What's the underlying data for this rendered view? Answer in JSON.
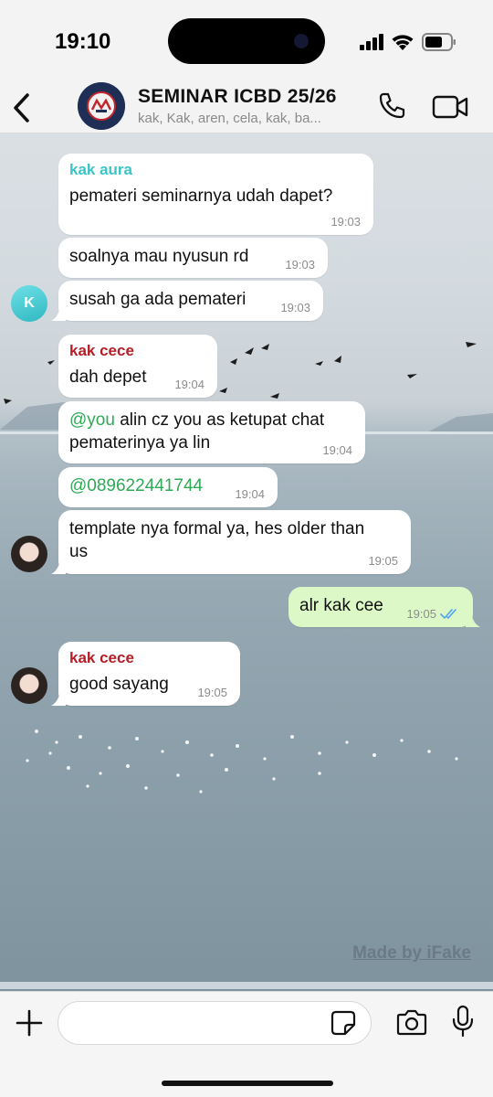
{
  "status_bar": {
    "time": "19:10"
  },
  "header": {
    "title": "SEMINAR ICBD 25/26",
    "members": "kak, Kak, aren, cela, kak, ba..."
  },
  "messages": [
    {
      "sender": "kak aura",
      "text": "pemateri seminarnya udah dapet?",
      "time": "19:03"
    },
    {
      "text": "soalnya mau nyusun rd",
      "time": "19:03"
    },
    {
      "text": "susah ga ada pemateri",
      "time": "19:03",
      "avatar_letter": "K"
    },
    {
      "sender": "kak cece",
      "text": "dah depet",
      "time": "19:04"
    },
    {
      "mention": "@you",
      "text_line1": " alin cz you as ketupat chat",
      "text_line2": "pematerinya ya lin",
      "time": "19:04"
    },
    {
      "mention": "@089622441744",
      "time": "19:04"
    },
    {
      "text_line1": "template nya formal ya, hes older than",
      "text_line2": "us",
      "time": "19:05"
    },
    {
      "text": "alr kak cee",
      "time": "19:05",
      "outgoing": true,
      "status": "read"
    },
    {
      "sender": "kak cece",
      "text": "good sayang",
      "time": "19:05"
    }
  ],
  "watermark": "Made by iFake",
  "input": {
    "placeholder": ""
  },
  "colors": {
    "outgoing_bubble": "#dcf8c6",
    "incoming_bubble": "#ffffff",
    "sender_aura": "#3bc4c6",
    "sender_cece": "#b51e27",
    "mention": "#2eaa56",
    "read_ticks": "#4fa3f0"
  },
  "icons": [
    "back-chevron-icon",
    "group-logo-icon",
    "phone-icon",
    "video-camera-icon",
    "plus-icon",
    "sticker-icon",
    "camera-icon",
    "microphone-icon",
    "double-check-icon",
    "signal-icon",
    "wifi-icon",
    "battery-icon"
  ]
}
